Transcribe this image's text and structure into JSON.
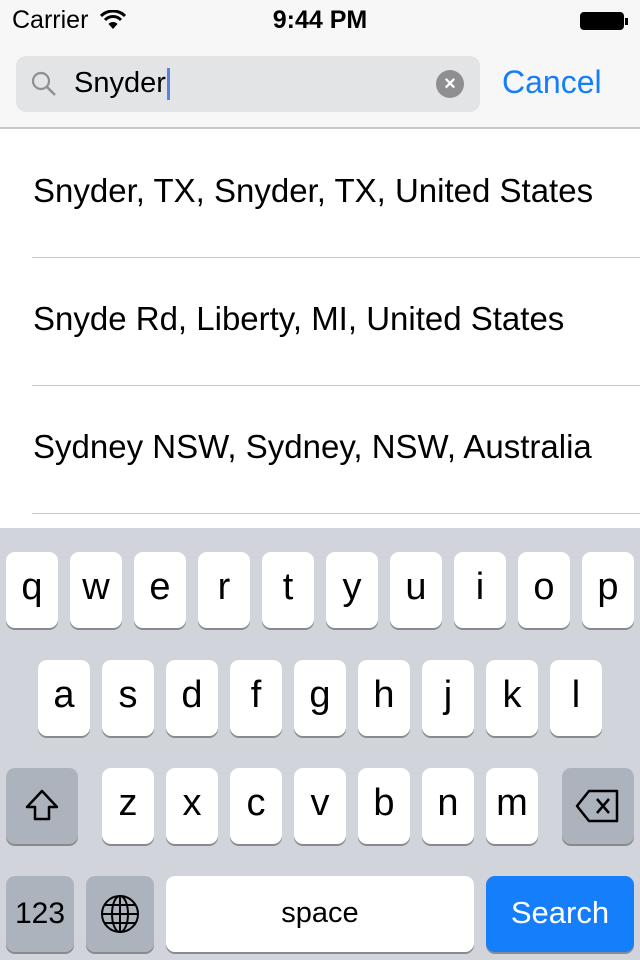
{
  "status_bar": {
    "carrier": "Carrier",
    "time": "9:44 PM",
    "battery_level": 1.0
  },
  "search": {
    "value": "Snyder",
    "cancel_label": "Cancel"
  },
  "results": [
    "Snyder, TX, Snyder, TX, United States",
    "Snyde Rd, Liberty, MI, United States",
    "Sydney NSW, Sydney, NSW, Australia"
  ],
  "keyboard": {
    "row1": [
      "q",
      "w",
      "e",
      "r",
      "t",
      "y",
      "u",
      "i",
      "o",
      "p"
    ],
    "row2": [
      "a",
      "s",
      "d",
      "f",
      "g",
      "h",
      "j",
      "k",
      "l"
    ],
    "row3": [
      "z",
      "x",
      "c",
      "v",
      "b",
      "n",
      "m"
    ],
    "numbers_label": "123",
    "space_label": "space",
    "search_label": "Search"
  },
  "colors": {
    "accent": "#147efb",
    "keyboard_bg": "#d1d5db"
  }
}
